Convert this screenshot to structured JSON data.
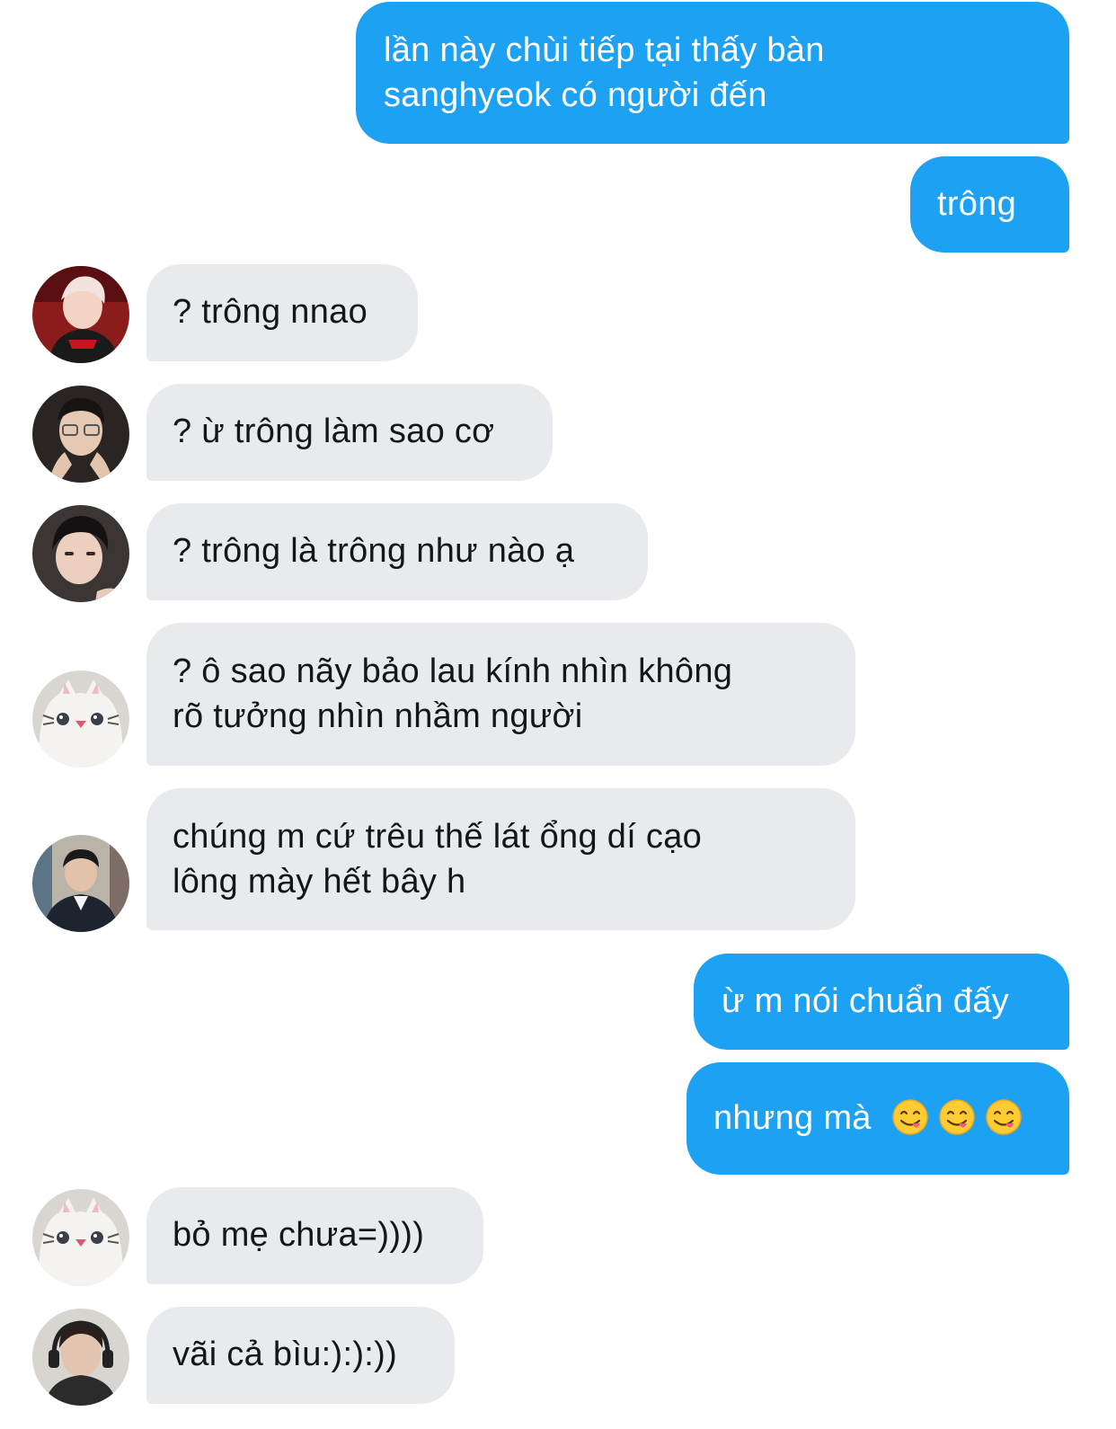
{
  "conversation": {
    "messages": [
      {
        "direction": "outgoing",
        "text": "lần này chùi tiếp tại thấy bàn\nsanghyeok có người đến"
      },
      {
        "direction": "outgoing",
        "text": "trông"
      },
      {
        "direction": "incoming",
        "text": "? trông nnao",
        "avatar": "avatar-red-hair-player"
      },
      {
        "direction": "incoming",
        "text": "? ừ trông làm sao cơ",
        "avatar": "avatar-glasses-player"
      },
      {
        "direction": "incoming",
        "text": "? trông là trông như nào ạ",
        "avatar": "avatar-dark-hair-player"
      },
      {
        "direction": "incoming",
        "text": "? ô sao nãy bảo lau kính nhìn không\nrõ tưởng nhìn nhầm người",
        "avatar": "avatar-cat-plush"
      },
      {
        "direction": "incoming",
        "text": "chúng m cứ trêu thế lát ổng dí cạo\nlông mày hết bây h",
        "avatar": "avatar-suit-man"
      },
      {
        "direction": "outgoing",
        "text": "ừ m nói chuẩn đấy"
      },
      {
        "direction": "outgoing",
        "text": "nhưng mà",
        "emojis": [
          "face-savoring-food-emoji",
          "face-savoring-food-emoji",
          "face-savoring-food-emoji"
        ]
      },
      {
        "direction": "incoming",
        "text": "bỏ mẹ chưa=))))",
        "avatar": "avatar-cat-plush"
      },
      {
        "direction": "incoming",
        "text": "vãi cả bìu:):):))",
        "avatar": "avatar-headset-player"
      }
    ]
  },
  "colors": {
    "outgoing_bubble": "#1da1f2",
    "incoming_bubble": "#e8eaed",
    "outgoing_text": "#ffffff",
    "incoming_text": "#14171a"
  }
}
